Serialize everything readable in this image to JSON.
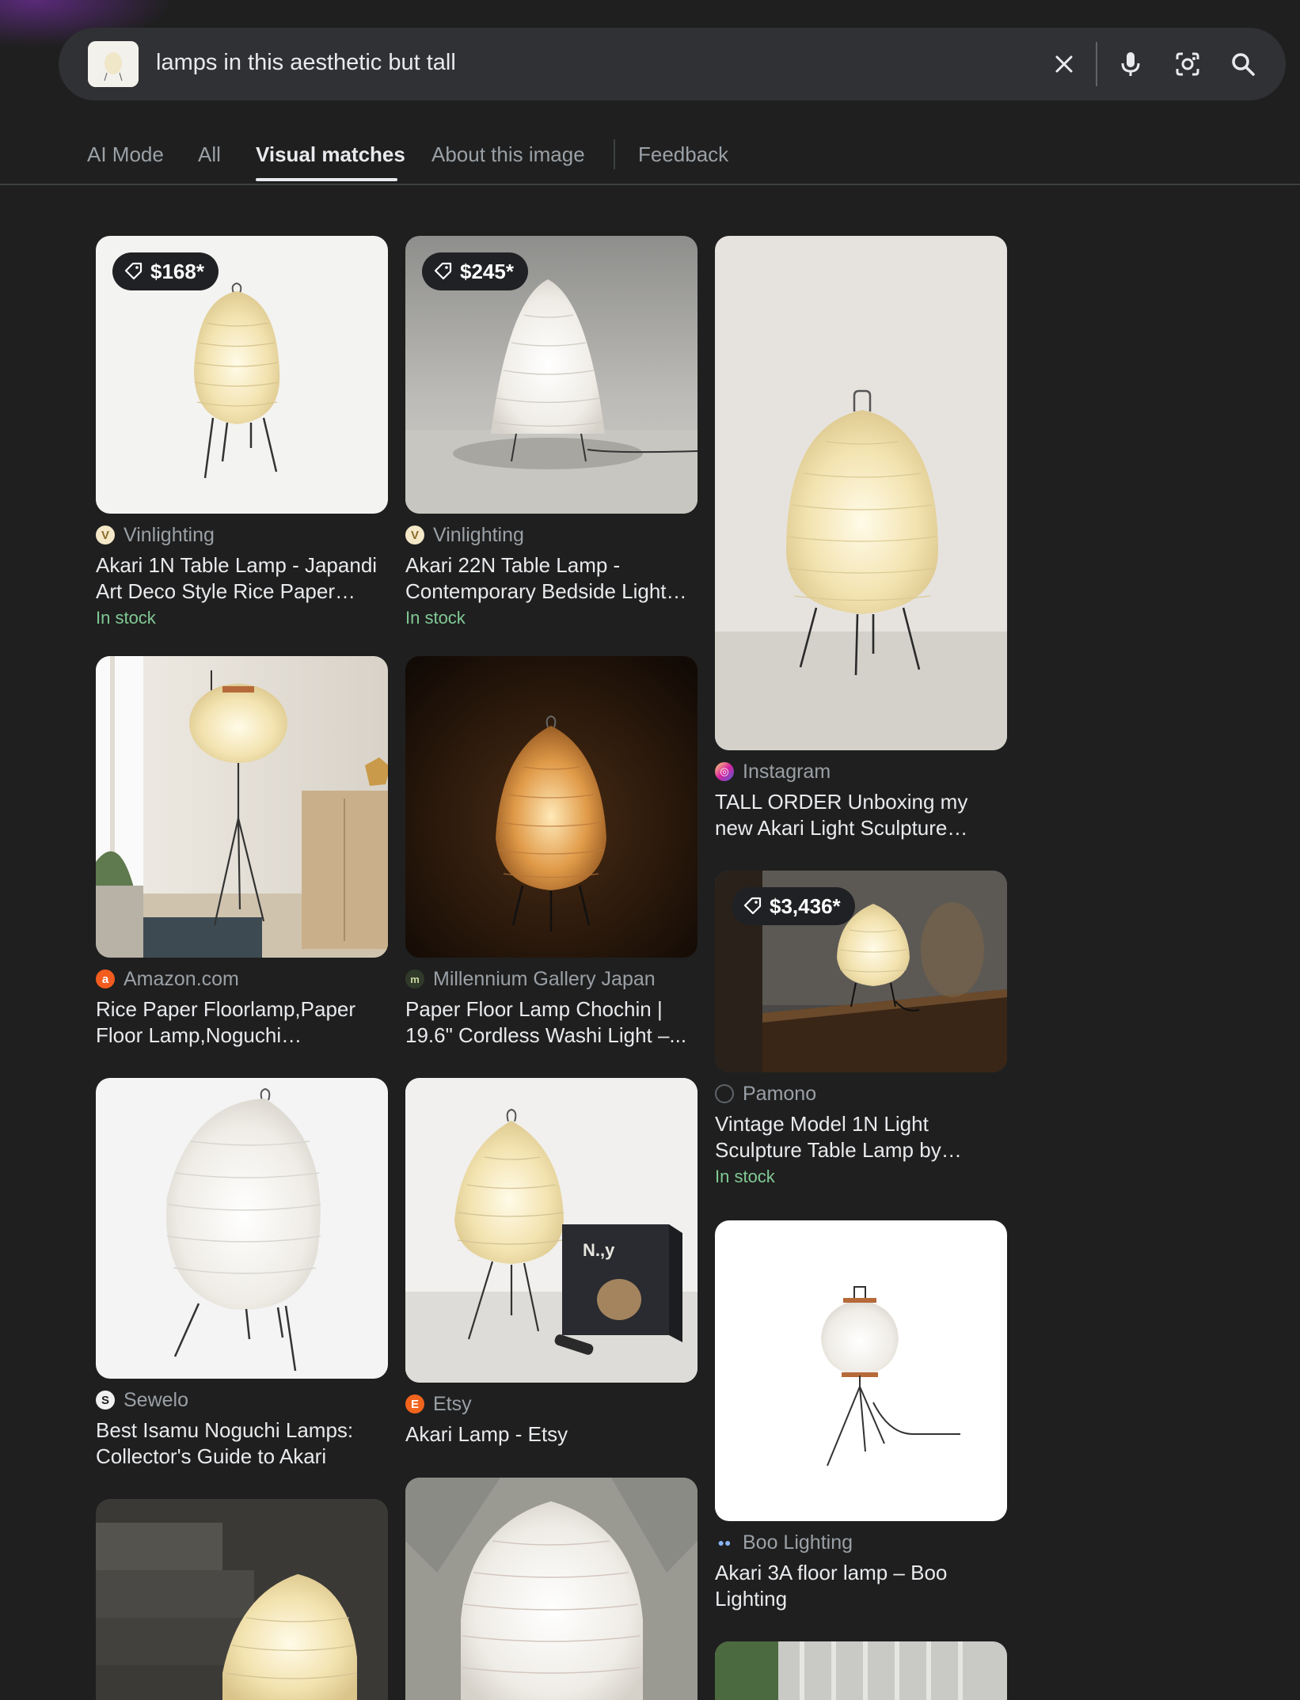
{
  "search": {
    "query": "lamps in this aesthetic but tall",
    "icons": [
      "clear-icon",
      "microphone-icon",
      "lens-icon",
      "search-icon"
    ]
  },
  "tabs": [
    {
      "label": "AI Mode"
    },
    {
      "label": "All"
    },
    {
      "label": "Visual matches",
      "active": true
    },
    {
      "label": "About this image"
    },
    {
      "label": "Feedback"
    }
  ],
  "results": [
    {
      "price": "$168*",
      "source": "Vinlighting",
      "title": "Akari 1N Table Lamp - Japandi Art Deco Style Rice Paper Lam...",
      "stock": "In stock"
    },
    {
      "price": "$245*",
      "source": "Vinlighting",
      "title": "Akari 22N Table Lamp - Contemporary Bedside Light –...",
      "stock": "In stock"
    },
    {
      "source": "Instagram",
      "title": "TALL ORDER Unboxing my new Akari Light Sculpture designed..."
    },
    {
      "source": "Amazon.com",
      "title": "Rice Paper Floorlamp,Paper Floor Lamp,Noguchi Lamp,Aka..."
    },
    {
      "source": "Millennium Gallery Japan",
      "title": "Paper Floor Lamp Chochin | 19.6\" Cordless Washi Light –..."
    },
    {
      "price": "$3,436*",
      "source": "Pamono",
      "title": "Vintage Model 1N Light Sculpture Table Lamp by Isam...",
      "stock": "In stock"
    },
    {
      "source": "Sewelo",
      "title": "Best Isamu Noguchi Lamps: Collector's Guide to Akari"
    },
    {
      "source": "Etsy",
      "title": "Akari Lamp - Etsy"
    },
    {
      "source": "Boo Lighting",
      "title": "Akari 3A floor lamp – Boo Lighting"
    }
  ],
  "colors": {
    "background": "#1f1f1f",
    "search_bar": "#303134",
    "in_stock": "#81c995",
    "instagram": "#d6249f",
    "amazon": "#f25c1f",
    "etsy": "#f1641e"
  }
}
